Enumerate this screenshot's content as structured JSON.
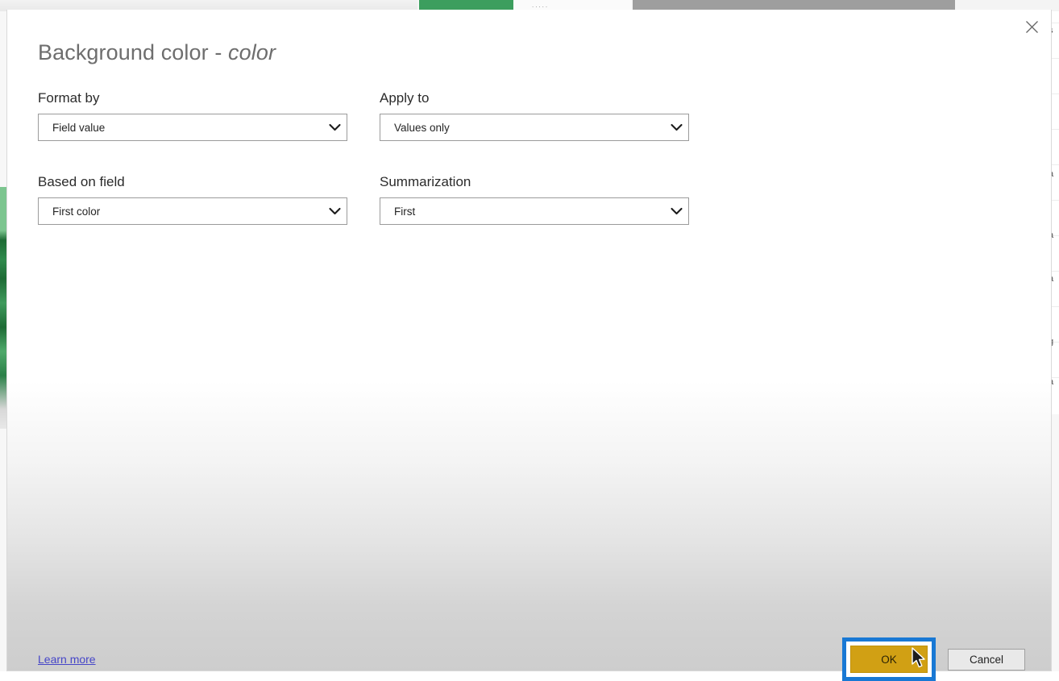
{
  "dialog": {
    "title_main": "Background color - ",
    "title_emphasis": "color",
    "close_icon": "close-icon"
  },
  "fields": [
    {
      "label": "Format by",
      "value": "Field value",
      "caret_icon": "chevron-down-icon"
    },
    {
      "label": "Apply to",
      "value": "Values only",
      "caret_icon": "chevron-down-icon"
    },
    {
      "label": "Based on field",
      "value": "First color",
      "caret_icon": "chevron-down-icon"
    },
    {
      "label": "Summarization",
      "value": "First",
      "caret_icon": "chevron-down-icon"
    }
  ],
  "footer": {
    "learn_more": "Learn more",
    "ok_label": "OK",
    "cancel_label": "Cancel"
  },
  "background": {
    "edge_glyphs": [
      "s",
      "a",
      "a",
      "a",
      "g",
      "a"
    ],
    "ribbon_dots": "....."
  },
  "colors": {
    "ok_button_fill": "#d1a014",
    "focus_ring": "#1878d4",
    "link": "#4646c8",
    "title_text": "#6e6e6e",
    "ribbon_green": "#3c9e5e",
    "ribbon_gray": "#9e9e9e"
  }
}
